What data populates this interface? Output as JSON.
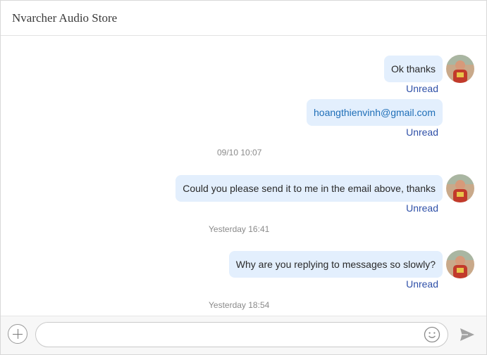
{
  "header": {
    "title": "Nvarcher Audio Store"
  },
  "messages": [
    {
      "text": "Ok thanks",
      "status": "Unread",
      "avatar": true,
      "link": false
    },
    {
      "text": "hoangthienvinh@gmail.com",
      "status": "Unread",
      "avatar": false,
      "link": true
    },
    {
      "timestamp": "09/10 10:07"
    },
    {
      "text": "Could you please send it to me in the email above, thanks",
      "status": "Unread",
      "avatar": true,
      "link": false
    },
    {
      "timestamp": "Yesterday 16:41"
    },
    {
      "text": "Why are you replying to messages so slowly?",
      "status": "Unread",
      "avatar": true,
      "link": false
    },
    {
      "timestamp": "Yesterday 18:54"
    }
  ],
  "composer": {
    "placeholder": ""
  },
  "icons": {
    "add": "plus-circle-icon",
    "emoji": "smiley-icon",
    "send": "paper-plane-icon"
  },
  "colors": {
    "bubble": "#e3effd",
    "status": "#2f50a8",
    "link": "#1f6fb8",
    "timestamp": "#8a8a8a"
  }
}
